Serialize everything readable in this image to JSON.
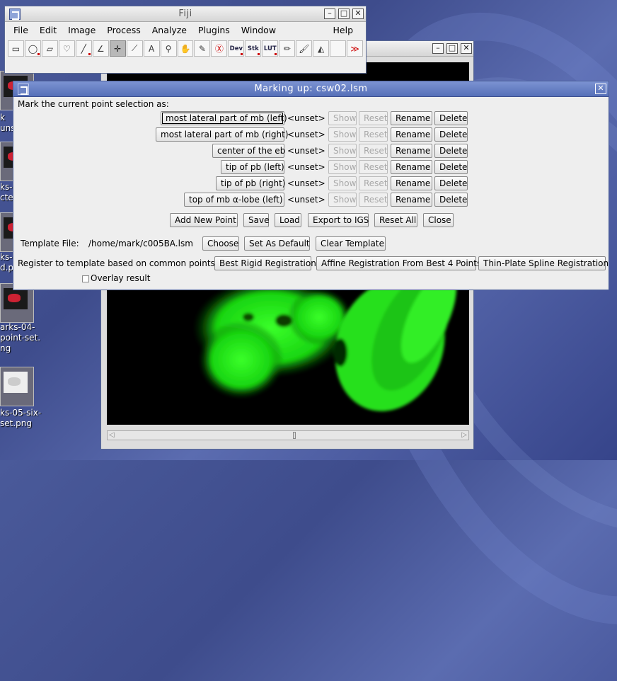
{
  "desktop": {
    "icons": [
      {
        "label": "k\nunsi"
      },
      {
        "label": "ks-0\ncte"
      },
      {
        "label": "ks-0\nd.p"
      },
      {
        "label": "arks-04-\npoint-set.\nng"
      },
      {
        "label": "ks-05-six-\nset.png"
      }
    ]
  },
  "fiji": {
    "title": "Fiji",
    "menus": [
      "File",
      "Edit",
      "Image",
      "Process",
      "Analyze",
      "Plugins",
      "Window",
      "Help"
    ],
    "tools": [
      {
        "name": "rectangle-tool-icon",
        "glyph": "▭"
      },
      {
        "name": "oval-tool-icon",
        "glyph": "◯"
      },
      {
        "name": "polygon-tool-icon",
        "glyph": "▱"
      },
      {
        "name": "freehand-tool-icon",
        "glyph": "♡"
      },
      {
        "name": "line-tool-icon",
        "glyph": "╱"
      },
      {
        "name": "angle-tool-icon",
        "glyph": "∠"
      },
      {
        "name": "point-tool-icon",
        "glyph": "✛"
      },
      {
        "name": "wand-tool-icon",
        "glyph": "⟋"
      },
      {
        "name": "text-tool-icon",
        "glyph": "A"
      },
      {
        "name": "magnifier-icon",
        "glyph": "⚲"
      },
      {
        "name": "hand-tool-icon",
        "glyph": "✋"
      },
      {
        "name": "dropper-icon",
        "glyph": "✎"
      },
      {
        "name": "stop-icon",
        "glyph": "Ⓧ"
      },
      {
        "name": "dev-tool-icon",
        "glyph": "Dev"
      },
      {
        "name": "stk-tool-icon",
        "glyph": "Stk"
      },
      {
        "name": "lut-tool-icon",
        "glyph": "LUT"
      },
      {
        "name": "pencil-icon",
        "glyph": "✏"
      },
      {
        "name": "brush-icon",
        "glyph": "🖌"
      },
      {
        "name": "bucket-icon",
        "glyph": "◭"
      },
      {
        "name": "empty-slot",
        "glyph": ""
      },
      {
        "name": "more-tools-icon",
        "glyph": "≫"
      }
    ]
  },
  "dialog": {
    "title": "Marking up: csw02.lsm",
    "intro": "Mark the current point selection as:",
    "points": [
      {
        "label": "most lateral part of mb (left)",
        "status": "<unset>"
      },
      {
        "label": "most lateral part of mb (right)",
        "status": "<unset>"
      },
      {
        "label": "center of the eb",
        "status": "<unset>"
      },
      {
        "label": "tip of pb (left)",
        "status": "<unset>"
      },
      {
        "label": "tip of pb (right)",
        "status": "<unset>"
      },
      {
        "label": "top of mb α-lobe (left)",
        "status": "<unset>"
      }
    ],
    "row_buttons": {
      "show": "Show",
      "reset": "Reset",
      "rename": "Rename",
      "delete": "Delete"
    },
    "actions": {
      "add": "Add New Point",
      "save": "Save",
      "load": "Load",
      "export": "Export to IGS",
      "reset_all": "Reset All",
      "close": "Close"
    },
    "template": {
      "label": "Template File:",
      "path": "/home/mark/c005BA.lsm",
      "choose": "Choose",
      "default": "Set As Default",
      "clear": "Clear Template"
    },
    "register": {
      "label": "Register to template based on common points:",
      "rigid": "Best Rigid Registration",
      "affine": "Affine Registration From Best 4 Points",
      "spline": "Thin-Plate Spline Registration"
    },
    "overlay": {
      "label": "Overlay result",
      "checked": false
    }
  }
}
